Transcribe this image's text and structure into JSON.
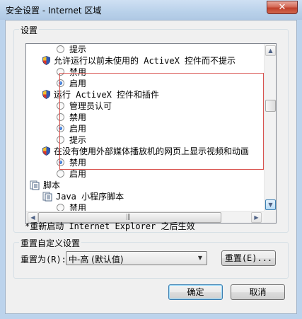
{
  "window": {
    "title": "安全设置 - Internet 区域",
    "close_label": "✕"
  },
  "settings": {
    "group_label": "设置",
    "items": [
      {
        "type": "radio",
        "label": "提示",
        "checked": false,
        "indent": 2
      },
      {
        "type": "shield",
        "label": "允许运行以前未使用的 ActiveX 控件而不提示",
        "indent": 1
      },
      {
        "type": "radio",
        "label": "禁用",
        "checked": false,
        "indent": 2
      },
      {
        "type": "radio",
        "label": "启用",
        "checked": true,
        "indent": 2
      },
      {
        "type": "shield",
        "label": "运行 ActiveX 控件和插件",
        "indent": 1
      },
      {
        "type": "radio",
        "label": "管理员认可",
        "checked": false,
        "indent": 2
      },
      {
        "type": "radio",
        "label": "禁用",
        "checked": false,
        "indent": 2
      },
      {
        "type": "radio",
        "label": "启用",
        "checked": true,
        "indent": 2
      },
      {
        "type": "radio",
        "label": "提示",
        "checked": false,
        "indent": 2
      },
      {
        "type": "shield",
        "label": "在没有使用外部媒体播放机的网页上显示视频和动画",
        "indent": 1
      },
      {
        "type": "radio",
        "label": "禁用",
        "checked": true,
        "indent": 2
      },
      {
        "type": "radio",
        "label": "启用",
        "checked": false,
        "indent": 2
      },
      {
        "type": "doc",
        "label": "脚本",
        "indent": 0
      },
      {
        "type": "doc",
        "label": "Java 小程序脚本",
        "indent": 1
      },
      {
        "type": "radio",
        "label": "禁用",
        "checked": false,
        "indent": 2
      }
    ],
    "restart_note": "*重新启动 Internet Explorer 之后生效"
  },
  "reset": {
    "group_label": "重置自定义设置",
    "reset_to_label": "重置为(R):",
    "selected_value": "中-高 (默认值)",
    "reset_button": "重置(E)..."
  },
  "footer": {
    "ok_button": "确定",
    "cancel_button": "取消"
  }
}
